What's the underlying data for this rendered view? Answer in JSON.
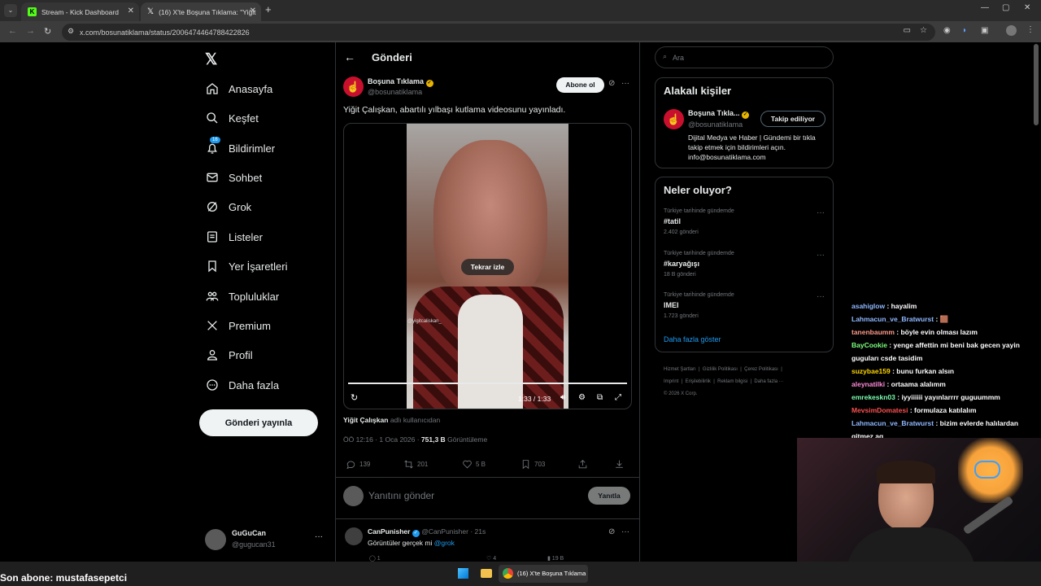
{
  "browser": {
    "tabs": [
      {
        "title": "Stream - Kick Dashboard",
        "active": false
      },
      {
        "title": "(16) X'te Boşuna Tıklama: \"Yiğit",
        "active": true
      }
    ],
    "url": "x.com/bosunatiklama/status/2006474464788422826"
  },
  "sidebar": {
    "items": [
      {
        "label": "Anasayfa",
        "icon": "home-icon"
      },
      {
        "label": "Keşfet",
        "icon": "search-icon"
      },
      {
        "label": "Bildirimler",
        "icon": "bell-icon",
        "badge": "16"
      },
      {
        "label": "Sohbet",
        "icon": "mail-icon"
      },
      {
        "label": "Grok",
        "icon": "grok-icon"
      },
      {
        "label": "Listeler",
        "icon": "list-icon"
      },
      {
        "label": "Yer İşaretleri",
        "icon": "bookmark-icon"
      },
      {
        "label": "Topluluklar",
        "icon": "people-icon"
      },
      {
        "label": "Premium",
        "icon": "x-logo-icon"
      },
      {
        "label": "Profil",
        "icon": "person-icon"
      },
      {
        "label": "Daha fazla",
        "icon": "more-circle-icon"
      }
    ],
    "post_button": "Gönderi yayınla",
    "account": {
      "name": "GuGuCan",
      "handle": "@gugucan31"
    }
  },
  "main": {
    "header_title": "Gönderi",
    "post": {
      "author_name": "Boşuna Tıklama",
      "author_handle": "@bosunatiklama",
      "subscribe_label": "Abone ol",
      "text": "Yiğit Çalışkan, abartılı yılbaşı kutlama videosunu yayınladı.",
      "video_watermark": "@yigitcaliskan_",
      "replay_label": "Tekrar izle",
      "video_time": "1:33 / 1:33",
      "video_progress": 1.0,
      "attribution_name": "Yiğit Çalışkan",
      "attribution_suffix": "adlı kullanıcıdan",
      "meta_time": "ÖÖ 12:16 · 1 Oca 2026 · ",
      "views_count": "751,3 B",
      "views_label": "Görüntüleme",
      "replies": "139",
      "reposts": "201",
      "likes": "5 B",
      "bookmarks": "703"
    },
    "reply_placeholder": "Yanıtını gönder",
    "reply_button": "Yanıtla",
    "reply": {
      "author_name": "CanPunisher",
      "author_handle": "@CanPunisher · 21s",
      "text": "Görüntüler gerçek mi ",
      "mention": "@grok",
      "replies": "1",
      "likes": "4",
      "views": "19 B"
    }
  },
  "right": {
    "search_placeholder": "Ara",
    "related_title": "Alakalı kişiler",
    "related_person": {
      "name": "Boşuna Tıkla...",
      "handle": "@bosunatiklama",
      "follow_label": "Takip ediliyor",
      "bio": "Dijital Medya ve Haber | Gündemi bir tıkla takip etmek için bildirimleri açın. info@bosunatiklama.com"
    },
    "trends_title": "Neler oluyor?",
    "trends": [
      {
        "category": "Türkiye tarihinde gündemde",
        "name": "#tatil",
        "count": "2.402 gönderi"
      },
      {
        "category": "Türkiye tarihinde gündemde",
        "name": "#karyağışı",
        "count": "18 B gönderi"
      },
      {
        "category": "Türkiye tarihinde gündemde",
        "name": "IMEI",
        "count": "1.723 gönderi"
      }
    ],
    "show_more": "Daha fazla göster",
    "footer_links": [
      "Hizmet Şartları",
      "Gizlilik Politikası",
      "Çerez Politikası",
      "Imprint",
      "Erişilebilirlik",
      "Reklam bilgisi",
      "Daha fazla ···"
    ],
    "copyright": "© 2026 X Corp."
  },
  "chat": {
    "messages": [
      {
        "user": "asahiglow",
        "color": "#8fb8ff",
        "text": " : hayalim"
      },
      {
        "user": "Lahmacun_ve_Bratwurst",
        "color": "#8fb8ff",
        "text": " : 🟫"
      },
      {
        "user": "tanenbaumm",
        "color": "#ff9a8a",
        "text": " : böyle evin olması lazım"
      },
      {
        "user": "BayCookie",
        "color": "#7dff7d",
        "text": " : yenge affettin mi beni bak gecen yayin guguları csde tasidim"
      },
      {
        "user": "suzybae159",
        "color": "#ffd700",
        "text": " : bunu furkan alsın"
      },
      {
        "user": "aleynatilki",
        "color": "#ff8ad8",
        "text": " : ortaama alalımm"
      },
      {
        "user": "emrekeskn03",
        "color": "#7dffb0",
        "text": " : iyyiiiiii yayınlarrrr guguummm"
      },
      {
        "user": "MevsimDomatesi",
        "color": "#ff5050",
        "text": " : formulaza katılalım"
      },
      {
        "user": "Lahmacun_ve_Bratwurst",
        "color": "#8fb8ff",
        "text": " : bizim evlerde halılardan gitmez aq"
      }
    ]
  },
  "overlay": {
    "last_sub": "Son abone: mustafasepetci"
  },
  "taskbar": {
    "chrome_label": "(16) X'te Boşuna Tıklama"
  }
}
